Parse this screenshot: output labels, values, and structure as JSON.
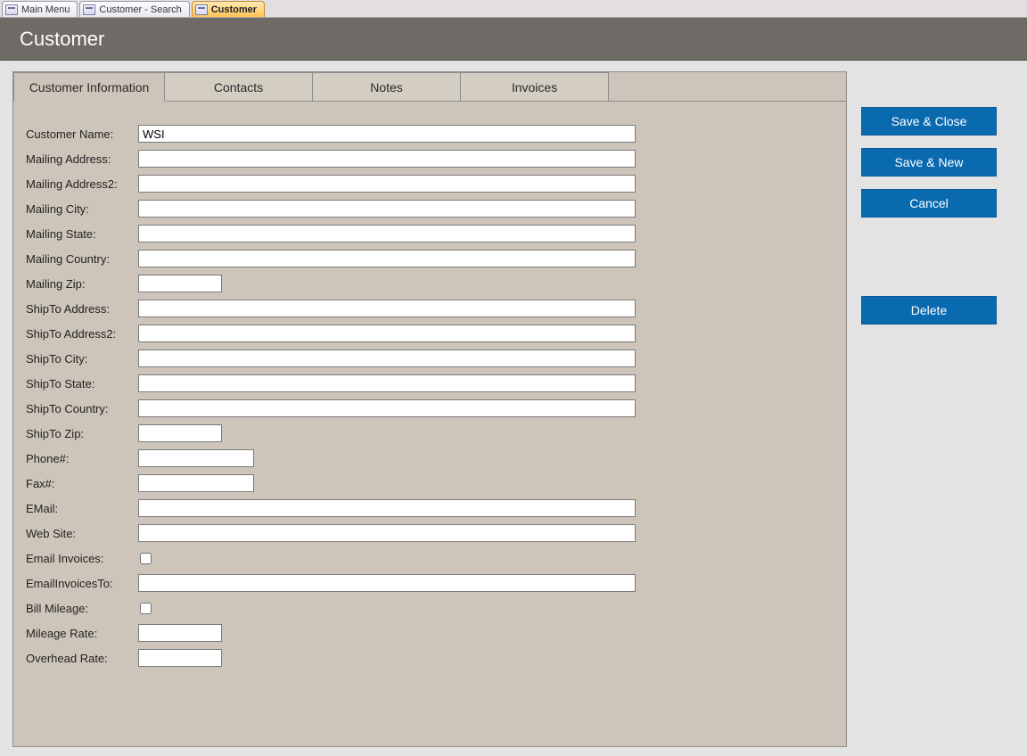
{
  "window_tabs": [
    {
      "label": "Main Menu",
      "active": false
    },
    {
      "label": "Customer - Search",
      "active": false
    },
    {
      "label": "Customer",
      "active": true
    }
  ],
  "header": {
    "title": "Customer"
  },
  "form_tabs": {
    "customer_info": "Customer Information",
    "contacts": "Contacts",
    "notes": "Notes",
    "invoices": "Invoices"
  },
  "fields": {
    "customer_name": {
      "label": "Customer Name:",
      "value": "WSI"
    },
    "mailing_address": {
      "label": "Mailing Address:",
      "value": ""
    },
    "mailing_address2": {
      "label": "Mailing Address2:",
      "value": ""
    },
    "mailing_city": {
      "label": "Mailing City:",
      "value": ""
    },
    "mailing_state": {
      "label": "Mailing State:",
      "value": ""
    },
    "mailing_country": {
      "label": "Mailing Country:",
      "value": ""
    },
    "mailing_zip": {
      "label": "Mailing Zip:",
      "value": ""
    },
    "shipto_address": {
      "label": "ShipTo Address:",
      "value": ""
    },
    "shipto_address2": {
      "label": "ShipTo Address2:",
      "value": ""
    },
    "shipto_city": {
      "label": "ShipTo City:",
      "value": ""
    },
    "shipto_state": {
      "label": "ShipTo State:",
      "value": ""
    },
    "shipto_country": {
      "label": "ShipTo Country:",
      "value": ""
    },
    "shipto_zip": {
      "label": "ShipTo Zip:",
      "value": ""
    },
    "phone": {
      "label": "Phone#:",
      "value": ""
    },
    "fax": {
      "label": "Fax#:",
      "value": ""
    },
    "email": {
      "label": "EMail:",
      "value": ""
    },
    "website": {
      "label": "Web Site:",
      "value": ""
    },
    "email_invoices": {
      "label": "Email Invoices:",
      "checked": false
    },
    "email_invoices_to": {
      "label": "EmailInvoicesTo:",
      "value": ""
    },
    "bill_mileage": {
      "label": "Bill Mileage:",
      "checked": false
    },
    "mileage_rate": {
      "label": "Mileage Rate:",
      "value": ""
    },
    "overhead_rate": {
      "label": "Overhead Rate:",
      "value": ""
    }
  },
  "actions": {
    "save_close": "Save & Close",
    "save_new": "Save & New",
    "cancel": "Cancel",
    "delete": "Delete"
  }
}
